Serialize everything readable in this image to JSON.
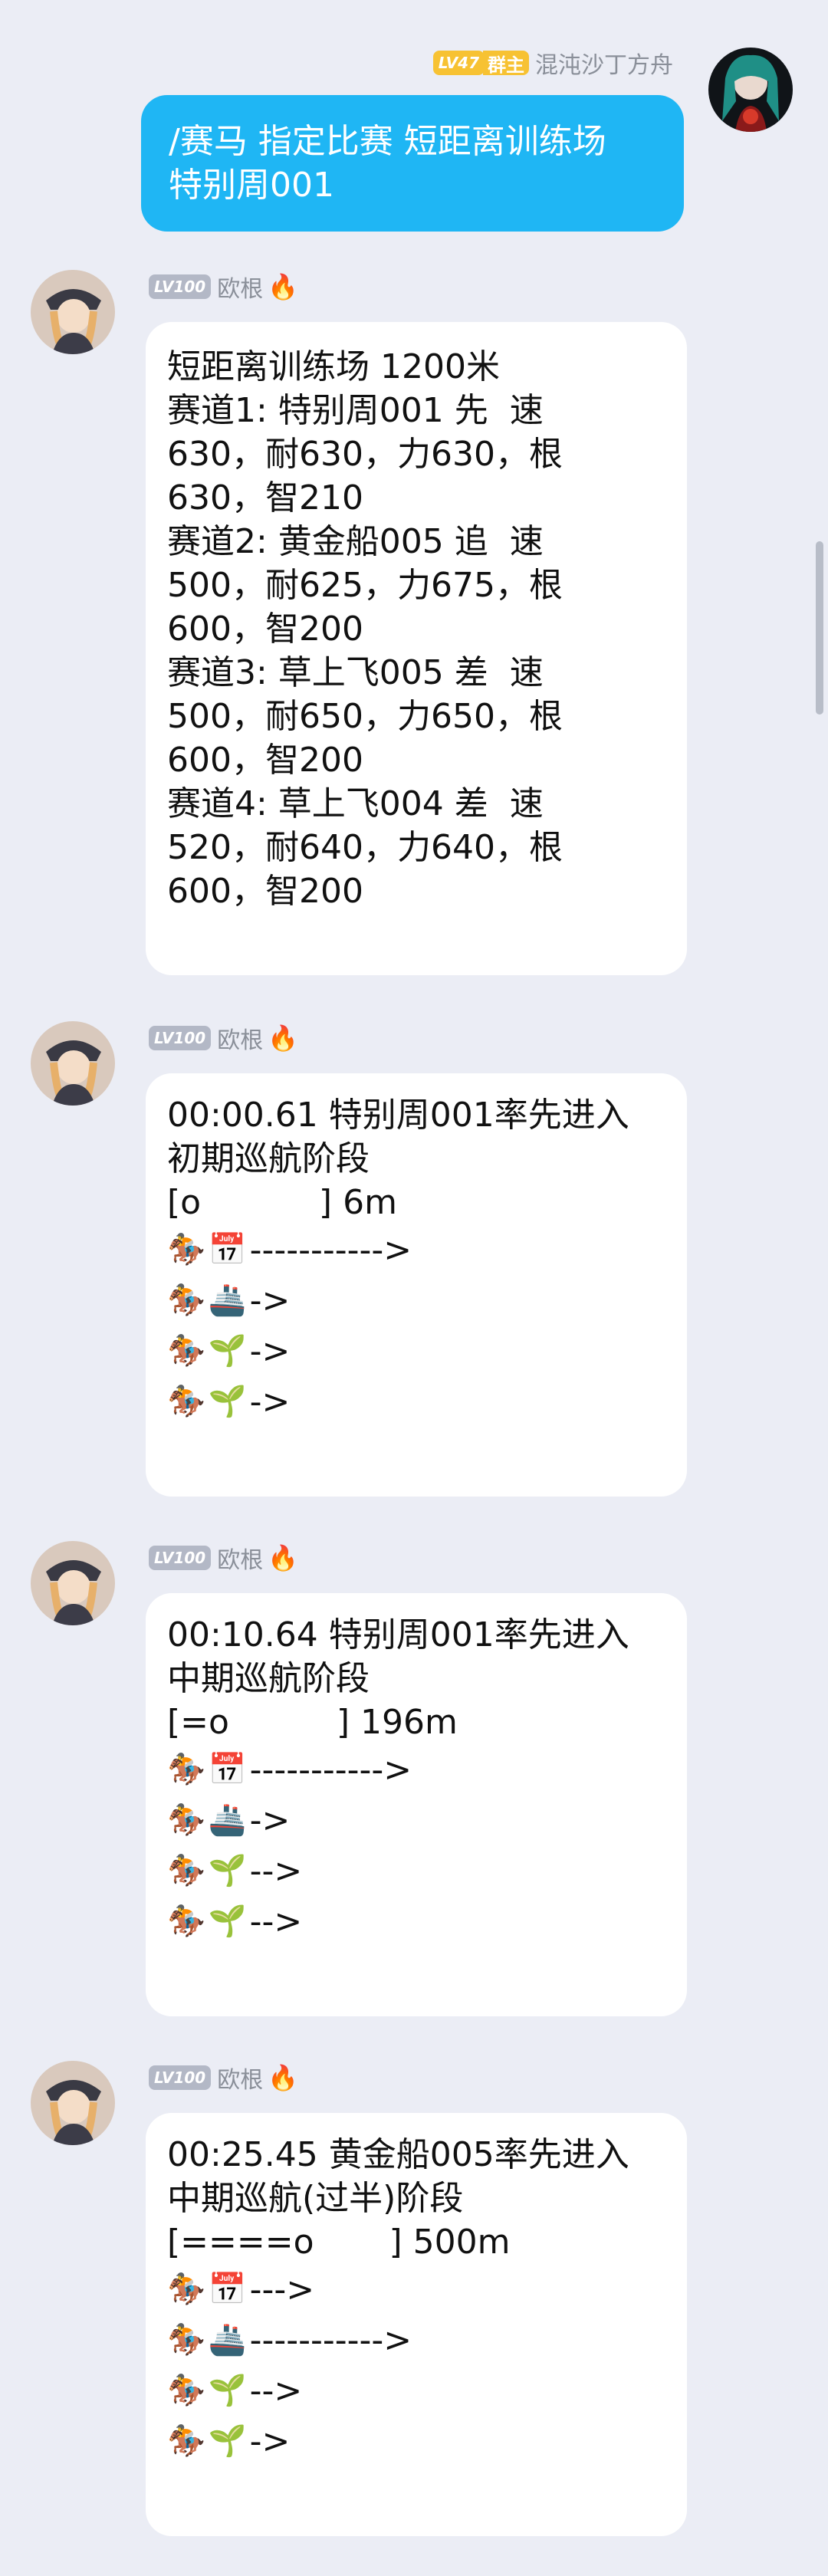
{
  "colors": {
    "background": "#ebedf5",
    "self_bubble": "#1fb6f4",
    "bot_bubble": "#ffffff",
    "level_gold": "#f7c233",
    "level_gray": "#b3b8c6"
  },
  "self_message": {
    "level": "LV47",
    "role": "群主",
    "username": "混沌沙丁方舟",
    "lines": [
      "/赛马 指定比赛 短距离训练场",
      "特别周001"
    ]
  },
  "bot": {
    "level": "LV100",
    "username": "欧根",
    "badge_icon": "fire-icon"
  },
  "messages": [
    {
      "lines": [
        "短距离训练场 1200米",
        "赛道1: 特别周001 先  速",
        "630，耐630，力630，根",
        "630，智210",
        "赛道2: 黄金船005 追  速",
        "500，耐625，力675，根",
        "600，智200",
        "赛道3: 草上飞005 差  速",
        "500，耐650，力650，根",
        "600，智200",
        "赛道4: 草上飞004 差  速",
        "520，耐640，力640，根",
        "600，智200"
      ],
      "tracks": []
    },
    {
      "lines": [
        "00:00.61 特别周001率先进入",
        "初期巡航阶段",
        "[o           ] 6m"
      ],
      "tracks": [
        {
          "horse": "🏇",
          "icon": "📅",
          "progress": "----------->"
        },
        {
          "horse": "🏇",
          "icon": "🚢",
          "progress": "->"
        },
        {
          "horse": "🏇",
          "icon": "🌱",
          "progress": "->"
        },
        {
          "horse": "🏇",
          "icon": "🌱",
          "progress": "->"
        }
      ]
    },
    {
      "lines": [
        "00:10.64 特别周001率先进入",
        "中期巡航阶段",
        "[=o          ] 196m"
      ],
      "tracks": [
        {
          "horse": "🏇",
          "icon": "📅",
          "progress": "----------->"
        },
        {
          "horse": "🏇",
          "icon": "🚢",
          "progress": "->"
        },
        {
          "horse": "🏇",
          "icon": "🌱",
          "progress": "-->"
        },
        {
          "horse": "🏇",
          "icon": "🌱",
          "progress": "-->"
        }
      ]
    },
    {
      "lines": [
        "00:25.45 黄金船005率先进入",
        "中期巡航(过半)阶段",
        "[====o       ] 500m"
      ],
      "tracks": [
        {
          "horse": "🏇",
          "icon": "📅",
          "progress": "--->"
        },
        {
          "horse": "🏇",
          "icon": "🚢",
          "progress": "----------->"
        },
        {
          "horse": "🏇",
          "icon": "🌱",
          "progress": "-->"
        },
        {
          "horse": "🏇",
          "icon": "🌱",
          "progress": "->"
        }
      ]
    }
  ]
}
